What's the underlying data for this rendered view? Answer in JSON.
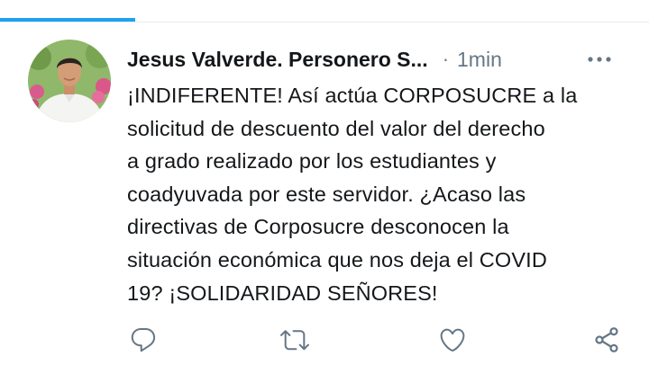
{
  "tabs": {
    "active_indicator_color": "#1da1f2"
  },
  "tweet": {
    "author_name": "Jesus Valverde. Personero S...",
    "separator": "·",
    "timestamp": "1min",
    "text": "¡INDIFERENTE! Así actúa CORPOSUCRE a la\nsolicitud de descuento del valor del derecho\na grado realizado por los estudiantes y\ncoadyuvada por este servidor. ¿Acaso las\ndirectivas de Corposucre desconocen la\nsituación económica que nos deja el COVID\n19? ¡SOLIDARIDAD SEÑORES!",
    "avatar_icon": "profile-photo",
    "more_icon": "more-options-icon"
  },
  "actions": [
    {
      "name": "reply",
      "icon": "comment-icon"
    },
    {
      "name": "retweet",
      "icon": "retweet-icon"
    },
    {
      "name": "like",
      "icon": "heart-icon"
    },
    {
      "name": "share",
      "icon": "share-icon"
    }
  ],
  "colors": {
    "text": "#14171a",
    "secondary": "#657786",
    "accent": "#1da1f2",
    "divider": "#e6ecf0"
  }
}
